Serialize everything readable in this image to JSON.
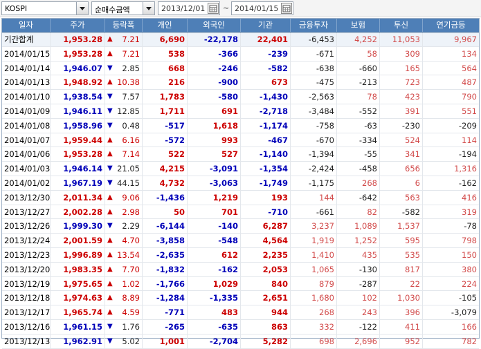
{
  "toolbar": {
    "market": "KOSPI",
    "metric": "순매수금액",
    "start_date": "2013/12/01",
    "separator": "~",
    "end_date": "2014/01/15"
  },
  "columns": [
    "일자",
    "주가",
    "등락폭",
    "개인",
    "외국인",
    "기관",
    "금융투자",
    "보험",
    "투신",
    "연기금등"
  ],
  "colors": {
    "up": "#cc0000",
    "down": "#0000b8",
    "header": "#4e7fb7"
  },
  "rows": [
    {
      "date": "기간합계",
      "price": "1,953.28",
      "dir": "up",
      "chg": "7.21",
      "ind": "6,690",
      "frn": "-22,178",
      "inst": "22,401",
      "fin": "-6,453",
      "ins": "4,252",
      "trust": "11,053",
      "pen": "9,967",
      "total": true
    },
    {
      "date": "2014/01/15",
      "price": "1,953.28",
      "dir": "up",
      "chg": "7.21",
      "ind": "538",
      "frn": "-366",
      "inst": "-239",
      "fin": "-671",
      "ins": "58",
      "trust": "309",
      "pen": "134"
    },
    {
      "date": "2014/01/14",
      "price": "1,946.07",
      "dir": "down",
      "chg": "2.85",
      "ind": "668",
      "frn": "-246",
      "inst": "-582",
      "fin": "-638",
      "ins": "-660",
      "trust": "165",
      "pen": "564"
    },
    {
      "date": "2014/01/13",
      "price": "1,948.92",
      "dir": "up",
      "chg": "10.38",
      "ind": "216",
      "frn": "-900",
      "inst": "673",
      "fin": "-475",
      "ins": "-213",
      "trust": "723",
      "pen": "487"
    },
    {
      "date": "2014/01/10",
      "price": "1,938.54",
      "dir": "down",
      "chg": "7.57",
      "ind": "1,783",
      "frn": "-580",
      "inst": "-1,430",
      "fin": "-2,563",
      "ins": "78",
      "trust": "423",
      "pen": "790"
    },
    {
      "date": "2014/01/09",
      "price": "1,946.11",
      "dir": "down",
      "chg": "12.85",
      "ind": "1,711",
      "frn": "691",
      "inst": "-2,718",
      "fin": "-3,484",
      "ins": "-552",
      "trust": "391",
      "pen": "551"
    },
    {
      "date": "2014/01/08",
      "price": "1,958.96",
      "dir": "down",
      "chg": "0.48",
      "ind": "-517",
      "frn": "1,618",
      "inst": "-1,174",
      "fin": "-758",
      "ins": "-63",
      "trust": "-230",
      "pen": "-209"
    },
    {
      "date": "2014/01/07",
      "price": "1,959.44",
      "dir": "up",
      "chg": "6.16",
      "ind": "-572",
      "frn": "993",
      "inst": "-467",
      "fin": "-670",
      "ins": "-334",
      "trust": "524",
      "pen": "114"
    },
    {
      "date": "2014/01/06",
      "price": "1,953.28",
      "dir": "up",
      "chg": "7.14",
      "ind": "522",
      "frn": "527",
      "inst": "-1,140",
      "fin": "-1,394",
      "ins": "-55",
      "trust": "341",
      "pen": "-194"
    },
    {
      "date": "2014/01/03",
      "price": "1,946.14",
      "dir": "down",
      "chg": "21.05",
      "ind": "4,215",
      "frn": "-3,091",
      "inst": "-1,354",
      "fin": "-2,424",
      "ins": "-458",
      "trust": "656",
      "pen": "1,316"
    },
    {
      "date": "2014/01/02",
      "price": "1,967.19",
      "dir": "down",
      "chg": "44.15",
      "ind": "4,732",
      "frn": "-3,063",
      "inst": "-1,749",
      "fin": "-1,175",
      "ins": "268",
      "trust": "6",
      "pen": "-162"
    },
    {
      "date": "2013/12/30",
      "price": "2,011.34",
      "dir": "up",
      "chg": "9.06",
      "ind": "-1,436",
      "frn": "1,219",
      "inst": "193",
      "fin": "144",
      "ins": "-642",
      "trust": "563",
      "pen": "416"
    },
    {
      "date": "2013/12/27",
      "price": "2,002.28",
      "dir": "up",
      "chg": "2.98",
      "ind": "50",
      "frn": "701",
      "inst": "-710",
      "fin": "-661",
      "ins": "82",
      "trust": "-582",
      "pen": "319"
    },
    {
      "date": "2013/12/26",
      "price": "1,999.30",
      "dir": "down",
      "chg": "2.29",
      "ind": "-6,144",
      "frn": "-140",
      "inst": "6,287",
      "fin": "3,237",
      "ins": "1,089",
      "trust": "1,537",
      "pen": "-78"
    },
    {
      "date": "2013/12/24",
      "price": "2,001.59",
      "dir": "up",
      "chg": "4.70",
      "ind": "-3,858",
      "frn": "-548",
      "inst": "4,564",
      "fin": "1,919",
      "ins": "1,252",
      "trust": "595",
      "pen": "798"
    },
    {
      "date": "2013/12/23",
      "price": "1,996.89",
      "dir": "up",
      "chg": "13.54",
      "ind": "-2,635",
      "frn": "612",
      "inst": "2,235",
      "fin": "1,410",
      "ins": "435",
      "trust": "535",
      "pen": "150"
    },
    {
      "date": "2013/12/20",
      "price": "1,983.35",
      "dir": "up",
      "chg": "7.70",
      "ind": "-1,832",
      "frn": "-162",
      "inst": "2,053",
      "fin": "1,065",
      "ins": "-130",
      "trust": "817",
      "pen": "380"
    },
    {
      "date": "2013/12/19",
      "price": "1,975.65",
      "dir": "up",
      "chg": "1.02",
      "ind": "-1,766",
      "frn": "1,029",
      "inst": "840",
      "fin": "879",
      "ins": "-287",
      "trust": "22",
      "pen": "224"
    },
    {
      "date": "2013/12/18",
      "price": "1,974.63",
      "dir": "up",
      "chg": "8.89",
      "ind": "-1,284",
      "frn": "-1,335",
      "inst": "2,651",
      "fin": "1,680",
      "ins": "102",
      "trust": "1,030",
      "pen": "-105"
    },
    {
      "date": "2013/12/17",
      "price": "1,965.74",
      "dir": "up",
      "chg": "4.59",
      "ind": "-771",
      "frn": "483",
      "inst": "944",
      "fin": "268",
      "ins": "243",
      "trust": "396",
      "pen": "-3,079"
    },
    {
      "date": "2013/12/16",
      "price": "1,961.15",
      "dir": "down",
      "chg": "1.76",
      "ind": "-265",
      "frn": "-635",
      "inst": "863",
      "fin": "332",
      "ins": "-122",
      "trust": "411",
      "pen": "166"
    },
    {
      "date": "2013/12/13",
      "price": "1,962.91",
      "dir": "down",
      "chg": "5.02",
      "ind": "1,001",
      "frn": "-2,704",
      "inst": "5,282",
      "fin": "698",
      "ins": "2,696",
      "trust": "952",
      "pen": "782"
    }
  ]
}
